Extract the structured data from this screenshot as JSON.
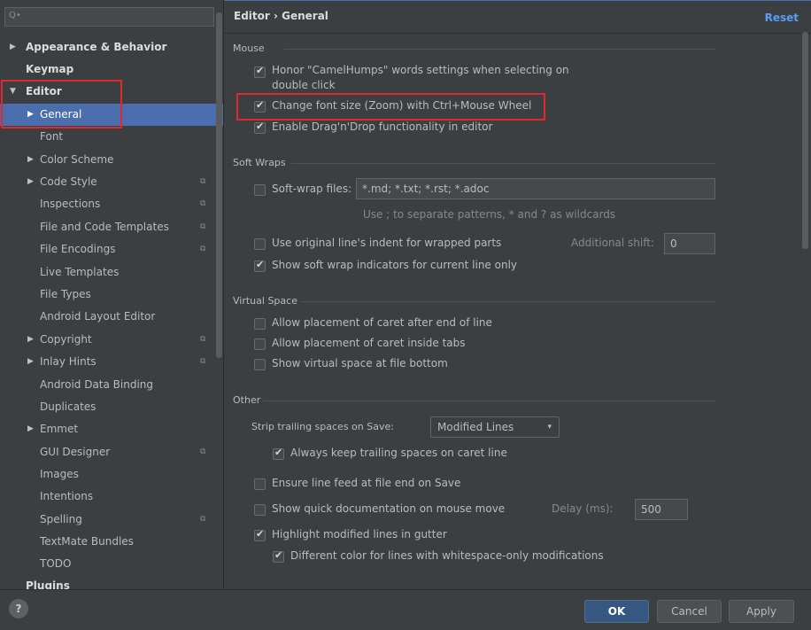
{
  "search": {
    "placeholder": "Q•"
  },
  "sidebar": {
    "items": [
      {
        "label": "Appearance & Behavior",
        "arrow": "▶"
      },
      {
        "label": "Keymap"
      },
      {
        "label": "Editor",
        "arrow": "▼"
      },
      {
        "label": "General",
        "arrow": "▶"
      },
      {
        "label": "Font"
      },
      {
        "label": "Color Scheme",
        "arrow": "▶"
      },
      {
        "label": "Code Style",
        "arrow": "▶",
        "project_icon": "⧉"
      },
      {
        "label": "Inspections",
        "project_icon": "⧉"
      },
      {
        "label": "File and Code Templates",
        "project_icon": "⧉"
      },
      {
        "label": "File Encodings",
        "project_icon": "⧉"
      },
      {
        "label": "Live Templates"
      },
      {
        "label": "File Types"
      },
      {
        "label": "Android Layout Editor"
      },
      {
        "label": "Copyright",
        "arrow": "▶",
        "project_icon": "⧉"
      },
      {
        "label": "Inlay Hints",
        "arrow": "▶",
        "project_icon": "⧉"
      },
      {
        "label": "Android Data Binding"
      },
      {
        "label": "Duplicates"
      },
      {
        "label": "Emmet",
        "arrow": "▶"
      },
      {
        "label": "GUI Designer",
        "project_icon": "⧉"
      },
      {
        "label": "Images"
      },
      {
        "label": "Intentions"
      },
      {
        "label": "Spelling",
        "project_icon": "⧉"
      },
      {
        "label": "TextMate Bundles"
      },
      {
        "label": "TODO"
      },
      {
        "label": "Plugins"
      }
    ]
  },
  "header": {
    "breadcrumb": "Editor › General",
    "reset": "Reset"
  },
  "sections": {
    "mouse": "Mouse",
    "soft_wraps": "Soft Wraps",
    "virtual_space": "Virtual Space",
    "other": "Other"
  },
  "mouse": {
    "camelhumps_line1": "Honor \"CamelHumps\" words settings when selecting on",
    "camelhumps_line2": "double click",
    "zoom": "Change font size (Zoom) with Ctrl+Mouse Wheel",
    "dragdrop": "Enable Drag'n'Drop functionality in editor"
  },
  "soft_wraps": {
    "files_label": "Soft-wrap files:",
    "files_value": "*.md; *.txt; *.rst; *.adoc",
    "files_hint": "Use ; to separate patterns, * and ? as wildcards",
    "original_indent": "Use original line's indent for wrapped parts",
    "additional_shift_label": "Additional shift:",
    "additional_shift_value": "0",
    "show_indicators": "Show soft wrap indicators for current line only"
  },
  "virtual_space": {
    "after_end": "Allow placement of caret after end of line",
    "inside_tabs": "Allow placement of caret inside tabs",
    "file_bottom": "Show virtual space at file bottom"
  },
  "other": {
    "strip_label": "Strip trailing spaces on Save:",
    "strip_value": "Modified Lines",
    "strip_caret": "▾",
    "keep_trailing": "Always keep trailing spaces on caret line",
    "line_feed": "Ensure line feed at file end on Save",
    "quick_doc": "Show quick documentation on mouse move",
    "delay_label": "Delay (ms):",
    "delay_value": "500",
    "highlight_modified": "Highlight modified lines in gutter",
    "different_color": "Different color for lines with whitespace-only modifications"
  },
  "footer": {
    "help": "?",
    "ok": "OK",
    "cancel": "Cancel",
    "apply": "Apply"
  },
  "colors": {
    "accent": "#4b6eaf",
    "highlight_box": "#e0282e",
    "link": "#589df6"
  }
}
